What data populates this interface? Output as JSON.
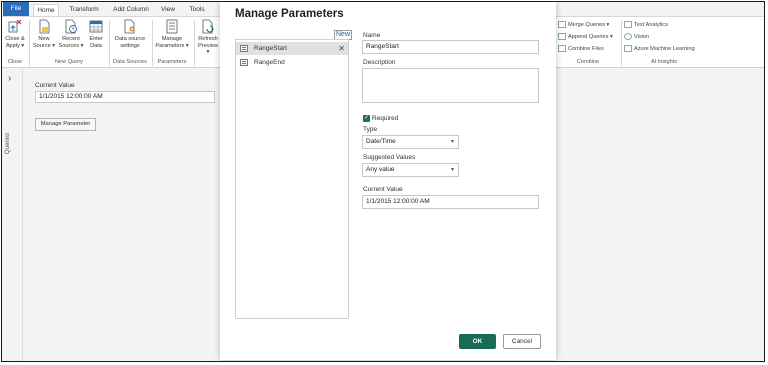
{
  "tabs": {
    "file": "File",
    "home": "Home",
    "transform": "Transform",
    "add_column": "Add Column",
    "view": "View",
    "tools": "Tools"
  },
  "ribbon": {
    "close_apply": "Close &\nApply",
    "close_apply_l1": "Close &",
    "close_apply_l2": "Apply ▾",
    "new_source_l1": "New",
    "new_source_l2": "Source ▾",
    "recent_sources_l1": "Recent",
    "recent_sources_l2": "Sources ▾",
    "enter_data_l1": "Enter",
    "enter_data_l2": "Data",
    "data_source_settings_l1": "Data source",
    "data_source_settings_l2": "settings",
    "manage_parameters_l1": "Manage",
    "manage_parameters_l2": "Parameters ▾",
    "refresh_preview_l1": "Refresh",
    "refresh_preview_l2": "Preview ▾",
    "group_close": "Close",
    "group_new_query": "New Query",
    "group_data_sources": "Data Sources",
    "group_parameters": "Parameters",
    "merge_queries": "Merge Queries ▾",
    "append_queries": "Append Queries ▾",
    "combine_files": "Combine Files",
    "group_combine": "Combine",
    "text_analytics": "Text Analytics",
    "vision": "Vision",
    "azure_ml": "Azure Machine Learning",
    "group_ai_insights": "AI Insights"
  },
  "rail": {
    "queries_label": "Queries"
  },
  "left_panel": {
    "current_value_label": "Current Value",
    "current_value": "1/1/2015 12:00:00 AM",
    "manage_parameter_button": "Manage Parameter"
  },
  "dialog": {
    "title": "Manage Parameters",
    "new_link": "New",
    "parameters": [
      {
        "label": "RangeStart",
        "selected": true
      },
      {
        "label": "RangeEnd",
        "selected": false
      }
    ],
    "name_label": "Name",
    "name_value": "RangeStart",
    "description_label": "Description",
    "description_value": "",
    "required_label": "Required",
    "required_checked": true,
    "type_label": "Type",
    "type_value": "Date/Time",
    "suggested_values_label": "Suggested Values",
    "suggested_values_value": "Any value",
    "current_value_label": "Current Value",
    "current_value": "1/1/2015 12:00:00 AM",
    "ok_button": "OK",
    "cancel_button": "Cancel"
  },
  "colors": {
    "file_tab": "#2b6cb8",
    "ok_button": "#1a6b54",
    "checkbox": "#1f6f55",
    "link": "#1d5fa8"
  }
}
